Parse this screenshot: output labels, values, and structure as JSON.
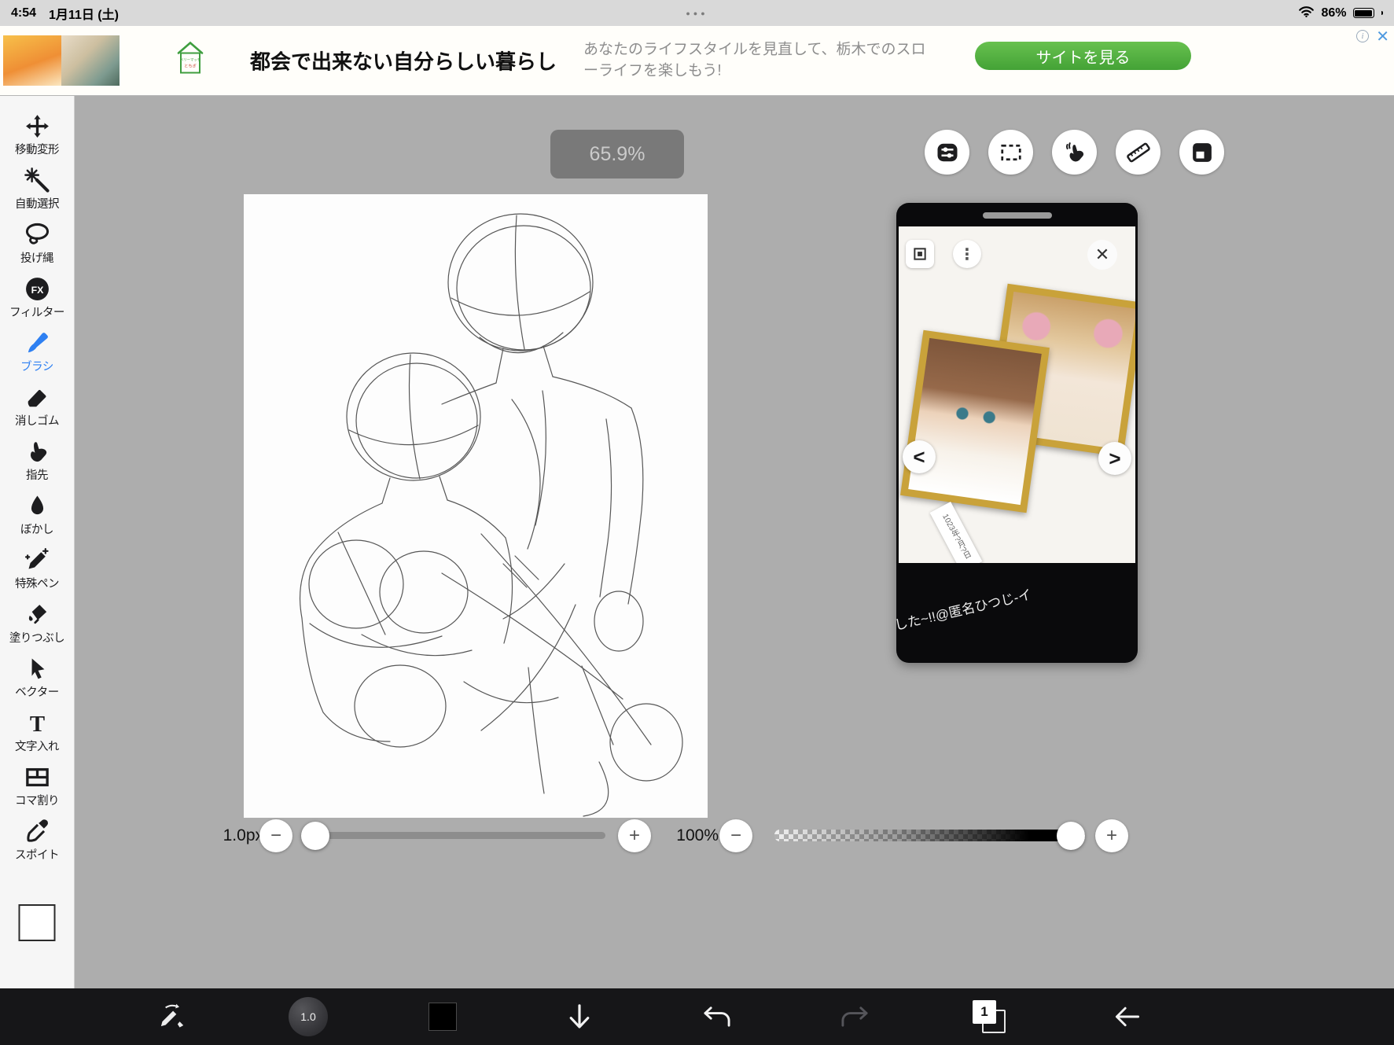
{
  "status_bar": {
    "time": "4:54",
    "date": "1月11日 (土)",
    "center_dots": "●●●",
    "battery_percent": "86%"
  },
  "ad_banner": {
    "logo_line1": "ベリーマッチ",
    "logo_line2": "とちぎ",
    "title": "都会で出来ない自分らしい暮らし",
    "subtitle": "あなたのライフスタイルを見直して、栃木でのスローライフを楽しもう!",
    "cta_label": "サイトを見る"
  },
  "left_toolbar": {
    "items": [
      {
        "label": "移動変形",
        "icon": "move-transform-icon"
      },
      {
        "label": "自動選択",
        "icon": "magic-wand-icon"
      },
      {
        "label": "投げ縄",
        "icon": "lasso-icon"
      },
      {
        "label": "フィルター",
        "icon": "fx-filter-icon",
        "icon_text": "FX"
      },
      {
        "label": "ブラシ",
        "icon": "brush-icon",
        "selected": true
      },
      {
        "label": "消しゴム",
        "icon": "eraser-icon"
      },
      {
        "label": "指先",
        "icon": "finger-icon"
      },
      {
        "label": "ぼかし",
        "icon": "blur-drop-icon"
      },
      {
        "label": "特殊ペン",
        "icon": "special-pen-icon"
      },
      {
        "label": "塗りつぶし",
        "icon": "fill-icon"
      },
      {
        "label": "ベクター",
        "icon": "vector-cursor-icon"
      },
      {
        "label": "文字入れ",
        "icon": "text-tool-icon",
        "icon_text": "T"
      },
      {
        "label": "コマ割り",
        "icon": "panel-split-icon"
      },
      {
        "label": "スポイト",
        "icon": "eyedropper-icon"
      }
    ]
  },
  "canvas": {
    "zoom_level": "65.9%"
  },
  "top_buttons": [
    {
      "icon": "settings-toggles-icon"
    },
    {
      "icon": "selection-marquee-icon"
    },
    {
      "icon": "hand-gesture-icon"
    },
    {
      "icon": "ruler-icon"
    },
    {
      "icon": "material-image-icon"
    }
  ],
  "video_panel": {
    "date_tag": "1023年?月?日",
    "caption": "した~!!@匿名ひつじ-イ"
  },
  "sliders": {
    "brush_size": "1.0px",
    "opacity": "100%"
  },
  "bottom_bar": {
    "brush_size_value": "1.0",
    "layer_number": "1"
  },
  "glyphs": {
    "minus": "−",
    "plus": "+",
    "close": "✕",
    "prev": "<",
    "next": ">",
    "kebab": "⋮",
    "info": "i"
  },
  "colors": {
    "accent_blue": "#2e80f2",
    "cta_green": "#54b145",
    "workspace_gray": "#adadad",
    "bottom_bar_dark": "#161618"
  }
}
